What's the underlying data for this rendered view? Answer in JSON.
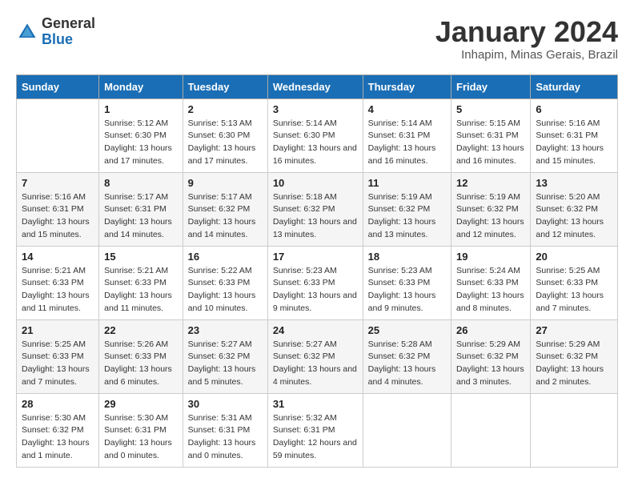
{
  "header": {
    "logo_general": "General",
    "logo_blue": "Blue",
    "title": "January 2024",
    "subtitle": "Inhapim, Minas Gerais, Brazil"
  },
  "weekdays": [
    "Sunday",
    "Monday",
    "Tuesday",
    "Wednesday",
    "Thursday",
    "Friday",
    "Saturday"
  ],
  "weeks": [
    [
      {
        "day": "",
        "sunrise": "",
        "sunset": "",
        "daylight": ""
      },
      {
        "day": "1",
        "sunrise": "Sunrise: 5:12 AM",
        "sunset": "Sunset: 6:30 PM",
        "daylight": "Daylight: 13 hours and 17 minutes."
      },
      {
        "day": "2",
        "sunrise": "Sunrise: 5:13 AM",
        "sunset": "Sunset: 6:30 PM",
        "daylight": "Daylight: 13 hours and 17 minutes."
      },
      {
        "day": "3",
        "sunrise": "Sunrise: 5:14 AM",
        "sunset": "Sunset: 6:30 PM",
        "daylight": "Daylight: 13 hours and 16 minutes."
      },
      {
        "day": "4",
        "sunrise": "Sunrise: 5:14 AM",
        "sunset": "Sunset: 6:31 PM",
        "daylight": "Daylight: 13 hours and 16 minutes."
      },
      {
        "day": "5",
        "sunrise": "Sunrise: 5:15 AM",
        "sunset": "Sunset: 6:31 PM",
        "daylight": "Daylight: 13 hours and 16 minutes."
      },
      {
        "day": "6",
        "sunrise": "Sunrise: 5:16 AM",
        "sunset": "Sunset: 6:31 PM",
        "daylight": "Daylight: 13 hours and 15 minutes."
      }
    ],
    [
      {
        "day": "7",
        "sunrise": "Sunrise: 5:16 AM",
        "sunset": "Sunset: 6:31 PM",
        "daylight": "Daylight: 13 hours and 15 minutes."
      },
      {
        "day": "8",
        "sunrise": "Sunrise: 5:17 AM",
        "sunset": "Sunset: 6:31 PM",
        "daylight": "Daylight: 13 hours and 14 minutes."
      },
      {
        "day": "9",
        "sunrise": "Sunrise: 5:17 AM",
        "sunset": "Sunset: 6:32 PM",
        "daylight": "Daylight: 13 hours and 14 minutes."
      },
      {
        "day": "10",
        "sunrise": "Sunrise: 5:18 AM",
        "sunset": "Sunset: 6:32 PM",
        "daylight": "Daylight: 13 hours and 13 minutes."
      },
      {
        "day": "11",
        "sunrise": "Sunrise: 5:19 AM",
        "sunset": "Sunset: 6:32 PM",
        "daylight": "Daylight: 13 hours and 13 minutes."
      },
      {
        "day": "12",
        "sunrise": "Sunrise: 5:19 AM",
        "sunset": "Sunset: 6:32 PM",
        "daylight": "Daylight: 13 hours and 12 minutes."
      },
      {
        "day": "13",
        "sunrise": "Sunrise: 5:20 AM",
        "sunset": "Sunset: 6:32 PM",
        "daylight": "Daylight: 13 hours and 12 minutes."
      }
    ],
    [
      {
        "day": "14",
        "sunrise": "Sunrise: 5:21 AM",
        "sunset": "Sunset: 6:33 PM",
        "daylight": "Daylight: 13 hours and 11 minutes."
      },
      {
        "day": "15",
        "sunrise": "Sunrise: 5:21 AM",
        "sunset": "Sunset: 6:33 PM",
        "daylight": "Daylight: 13 hours and 11 minutes."
      },
      {
        "day": "16",
        "sunrise": "Sunrise: 5:22 AM",
        "sunset": "Sunset: 6:33 PM",
        "daylight": "Daylight: 13 hours and 10 minutes."
      },
      {
        "day": "17",
        "sunrise": "Sunrise: 5:23 AM",
        "sunset": "Sunset: 6:33 PM",
        "daylight": "Daylight: 13 hours and 9 minutes."
      },
      {
        "day": "18",
        "sunrise": "Sunrise: 5:23 AM",
        "sunset": "Sunset: 6:33 PM",
        "daylight": "Daylight: 13 hours and 9 minutes."
      },
      {
        "day": "19",
        "sunrise": "Sunrise: 5:24 AM",
        "sunset": "Sunset: 6:33 PM",
        "daylight": "Daylight: 13 hours and 8 minutes."
      },
      {
        "day": "20",
        "sunrise": "Sunrise: 5:25 AM",
        "sunset": "Sunset: 6:33 PM",
        "daylight": "Daylight: 13 hours and 7 minutes."
      }
    ],
    [
      {
        "day": "21",
        "sunrise": "Sunrise: 5:25 AM",
        "sunset": "Sunset: 6:33 PM",
        "daylight": "Daylight: 13 hours and 7 minutes."
      },
      {
        "day": "22",
        "sunrise": "Sunrise: 5:26 AM",
        "sunset": "Sunset: 6:33 PM",
        "daylight": "Daylight: 13 hours and 6 minutes."
      },
      {
        "day": "23",
        "sunrise": "Sunrise: 5:27 AM",
        "sunset": "Sunset: 6:32 PM",
        "daylight": "Daylight: 13 hours and 5 minutes."
      },
      {
        "day": "24",
        "sunrise": "Sunrise: 5:27 AM",
        "sunset": "Sunset: 6:32 PM",
        "daylight": "Daylight: 13 hours and 4 minutes."
      },
      {
        "day": "25",
        "sunrise": "Sunrise: 5:28 AM",
        "sunset": "Sunset: 6:32 PM",
        "daylight": "Daylight: 13 hours and 4 minutes."
      },
      {
        "day": "26",
        "sunrise": "Sunrise: 5:29 AM",
        "sunset": "Sunset: 6:32 PM",
        "daylight": "Daylight: 13 hours and 3 minutes."
      },
      {
        "day": "27",
        "sunrise": "Sunrise: 5:29 AM",
        "sunset": "Sunset: 6:32 PM",
        "daylight": "Daylight: 13 hours and 2 minutes."
      }
    ],
    [
      {
        "day": "28",
        "sunrise": "Sunrise: 5:30 AM",
        "sunset": "Sunset: 6:32 PM",
        "daylight": "Daylight: 13 hours and 1 minute."
      },
      {
        "day": "29",
        "sunrise": "Sunrise: 5:30 AM",
        "sunset": "Sunset: 6:31 PM",
        "daylight": "Daylight: 13 hours and 0 minutes."
      },
      {
        "day": "30",
        "sunrise": "Sunrise: 5:31 AM",
        "sunset": "Sunset: 6:31 PM",
        "daylight": "Daylight: 13 hours and 0 minutes."
      },
      {
        "day": "31",
        "sunrise": "Sunrise: 5:32 AM",
        "sunset": "Sunset: 6:31 PM",
        "daylight": "Daylight: 12 hours and 59 minutes."
      },
      {
        "day": "",
        "sunrise": "",
        "sunset": "",
        "daylight": ""
      },
      {
        "day": "",
        "sunrise": "",
        "sunset": "",
        "daylight": ""
      },
      {
        "day": "",
        "sunrise": "",
        "sunset": "",
        "daylight": ""
      }
    ]
  ]
}
